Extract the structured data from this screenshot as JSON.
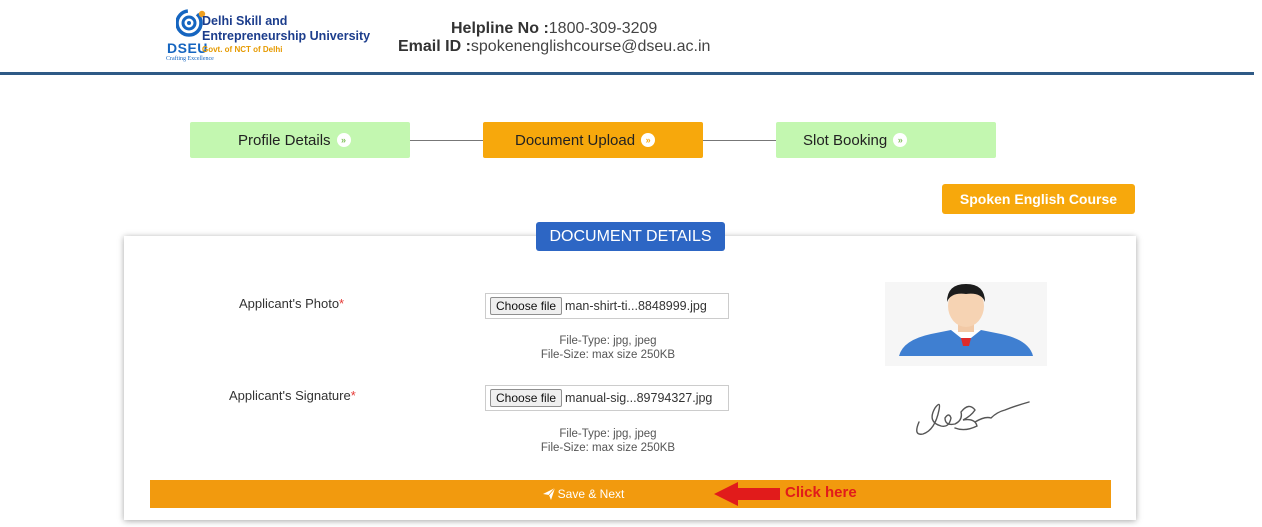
{
  "header": {
    "logo": {
      "abbr": "DSEU",
      "tagline": "Crafting Excellence",
      "name_line1": "Delhi Skill and",
      "name_line2": "Entrepreneurship University",
      "govt": "Govt. of NCT of Delhi"
    },
    "helpline_label": "Helpline No :",
    "helpline_value": "1800-309-3209",
    "email_label": "Email ID :",
    "email_value": "spokenenglishcourse@dseu.ac.in"
  },
  "steps": [
    {
      "label": "Profile Details",
      "state": "completed",
      "color": "#c3f7b0"
    },
    {
      "label": "Document Upload",
      "state": "active",
      "color": "#f7a80c"
    },
    {
      "label": "Slot Booking",
      "state": "pending",
      "color": "#c3f7b0"
    }
  ],
  "course_button": "Spoken English Course",
  "section_title": "DOCUMENT DETAILS",
  "fields": {
    "photo": {
      "label": "Applicant's Photo",
      "required_mark": "*",
      "button": "Choose file",
      "filename": "man-shirt-ti...8848999.jpg",
      "file_type": "File-Type: jpg, jpeg",
      "file_size": "File-Size: max size 250KB"
    },
    "signature": {
      "label": "Applicant's Signature",
      "required_mark": "*",
      "button": "Choose file",
      "filename": "manual-sig...89794327.jpg",
      "file_type": "File-Type: jpg, jpeg",
      "file_size": "File-Size: max size 250KB"
    }
  },
  "save_button": "Save & Next",
  "annotation": "Click here",
  "colors": {
    "accent_orange": "#f29a0e",
    "accent_blue": "#2d66c4",
    "step_green": "#c3f7b0",
    "annotation_red": "#e11b1b"
  }
}
